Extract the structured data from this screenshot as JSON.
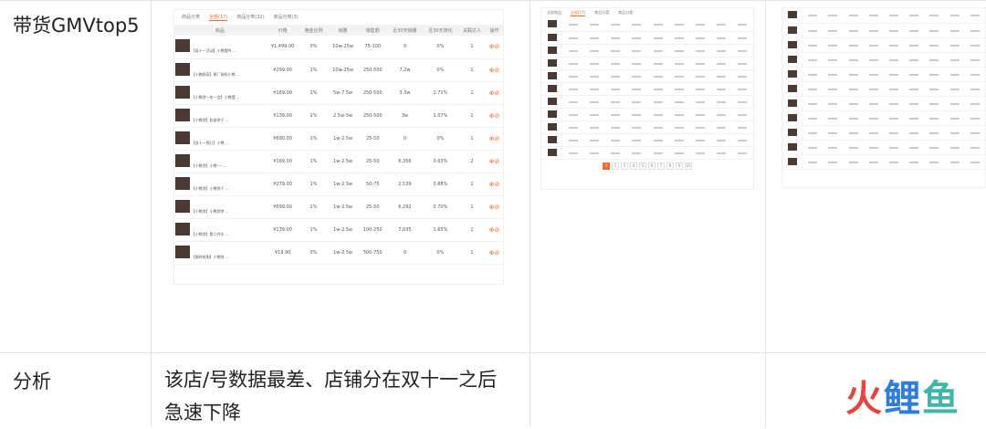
{
  "row1": {
    "label": "带货GMVtop5"
  },
  "row2": {
    "label": "分析",
    "text": "该店/号数据最差、店铺分在双十一之后急速下降"
  },
  "logo": {
    "chars": [
      "火",
      "鲤",
      "鱼"
    ]
  },
  "shot1": {
    "tabs": [
      "商品分类",
      "全部(17)",
      "商品分类(32)",
      "商品分类(3)"
    ],
    "headers": [
      "商品",
      "价格",
      "佣金比例",
      "销量",
      "销售额",
      "近30天销量",
      "近30天转化",
      "关联达人",
      "操作"
    ],
    "rows": [
      [
        "【双十一活动】小熊摆件 ...",
        "¥1,499.00",
        "0%",
        "10w-25w",
        "75-100",
        "0",
        "0%",
        "1"
      ],
      [
        "【小猪佩奇】原厂授权小熊 ...",
        "¥299.00",
        "1%",
        "10w-25w",
        "250-500",
        "7.2w",
        "0%",
        "1"
      ],
      [
        "【小熊贷一年一会】小熊摆 ...",
        "¥169.00",
        "1%",
        "5w-7.5w",
        "250-500",
        "3.3w",
        "1.71%",
        "1"
      ],
      [
        "【小熊贷】松鼠饼干 ...",
        "¥139.00",
        "1%",
        "2.5w-5w",
        "250-500",
        "3w",
        "1.07%",
        "1"
      ],
      [
        "【双十一预订】小熊 ...",
        "¥690.00",
        "1%",
        "1w-2.5w",
        "25-50",
        "0",
        "0%",
        "1"
      ],
      [
        "【小熊贷】小熊·一 ...",
        "¥169.00",
        "1%",
        "1w-2.5w",
        "25-50",
        "6,356",
        "0.63%",
        "2"
      ],
      [
        "【小熊贷】小熊饼干 ...",
        "¥279.00",
        "1%",
        "1w-2.5w",
        "50-75",
        "2,539",
        "0.88%",
        "1"
      ],
      [
        "【小熊贷】小熊贷饼 ...",
        "¥699.00",
        "1%",
        "1w-2.5w",
        "25-50",
        "6,292",
        "0.70%",
        "1"
      ],
      [
        "【小熊贷】第二件半 ...",
        "¥139.00",
        "1%",
        "1w-2.5w",
        "100-250",
        "7,035",
        "1.65%",
        "1"
      ],
      [
        "【限时抢购】小熊饼 ...",
        "¥19.90",
        "0%",
        "1w-2.5w",
        "500-750",
        "0",
        "0%",
        "1"
      ]
    ]
  },
  "shot2": {
    "tabs": [
      "全部商品",
      "全部(17)",
      "商品分类",
      "商品分类"
    ],
    "rows": 11,
    "pager": [
      "1",
      "2",
      "3",
      "4",
      "5",
      "6",
      "7",
      "8",
      "9",
      "10"
    ]
  },
  "shot3": {
    "rows": 11
  }
}
